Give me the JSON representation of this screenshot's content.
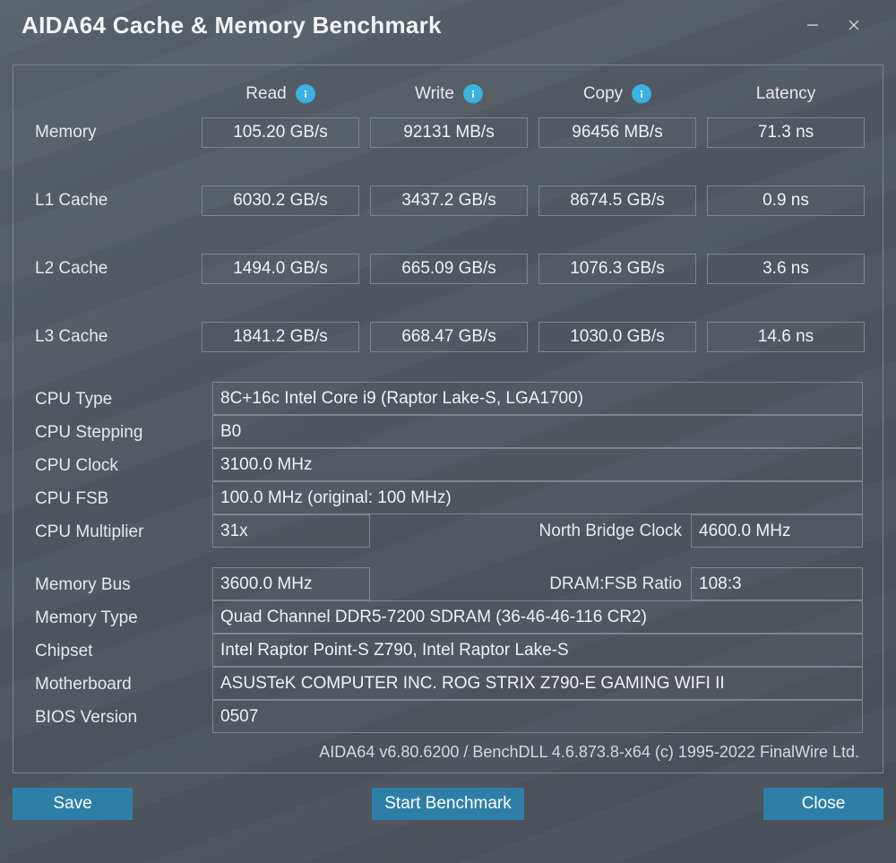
{
  "window": {
    "title": "AIDA64 Cache & Memory Benchmark"
  },
  "headers": {
    "read": "Read",
    "write": "Write",
    "copy": "Copy",
    "latency": "Latency"
  },
  "rows": {
    "memory": {
      "label": "Memory",
      "read": "105.20 GB/s",
      "write": "92131 MB/s",
      "copy": "96456 MB/s",
      "latency": "71.3 ns"
    },
    "l1cache": {
      "label": "L1 Cache",
      "read": "6030.2 GB/s",
      "write": "3437.2 GB/s",
      "copy": "8674.5 GB/s",
      "latency": "0.9 ns"
    },
    "l2cache": {
      "label": "L2 Cache",
      "read": "1494.0 GB/s",
      "write": "665.09 GB/s",
      "copy": "1076.3 GB/s",
      "latency": "3.6 ns"
    },
    "l3cache": {
      "label": "L3 Cache",
      "read": "1841.2 GB/s",
      "write": "668.47 GB/s",
      "copy": "1030.0 GB/s",
      "latency": "14.6 ns"
    }
  },
  "sys": {
    "cpu_type": {
      "label": "CPU Type",
      "value": "8C+16c Intel Core i9  (Raptor Lake-S, LGA1700)"
    },
    "cpu_stepping": {
      "label": "CPU Stepping",
      "value": "B0"
    },
    "cpu_clock": {
      "label": "CPU Clock",
      "value": "3100.0 MHz"
    },
    "cpu_fsb": {
      "label": "CPU FSB",
      "value": "100.0 MHz  (original: 100 MHz)"
    },
    "cpu_mult": {
      "label": "CPU Multiplier",
      "value": "31x",
      "nb_label": "North Bridge Clock",
      "nb_value": "4600.0 MHz"
    },
    "mem_bus": {
      "label": "Memory Bus",
      "value": "3600.0 MHz",
      "ratio_label": "DRAM:FSB Ratio",
      "ratio_value": "108:3"
    },
    "mem_type": {
      "label": "Memory Type",
      "value": "Quad Channel DDR5-7200 SDRAM  (36-46-46-116 CR2)"
    },
    "chipset": {
      "label": "Chipset",
      "value": "Intel Raptor Point-S Z790, Intel Raptor Lake-S"
    },
    "motherboard": {
      "label": "Motherboard",
      "value": "ASUSTeK COMPUTER INC. ROG STRIX Z790-E GAMING WIFI II"
    },
    "bios": {
      "label": "BIOS Version",
      "value": "0507"
    }
  },
  "footer": "AIDA64 v6.80.6200 / BenchDLL 4.6.873.8-x64  (c) 1995-2022 FinalWire Ltd.",
  "buttons": {
    "save": "Save",
    "start": "Start Benchmark",
    "close": "Close"
  }
}
